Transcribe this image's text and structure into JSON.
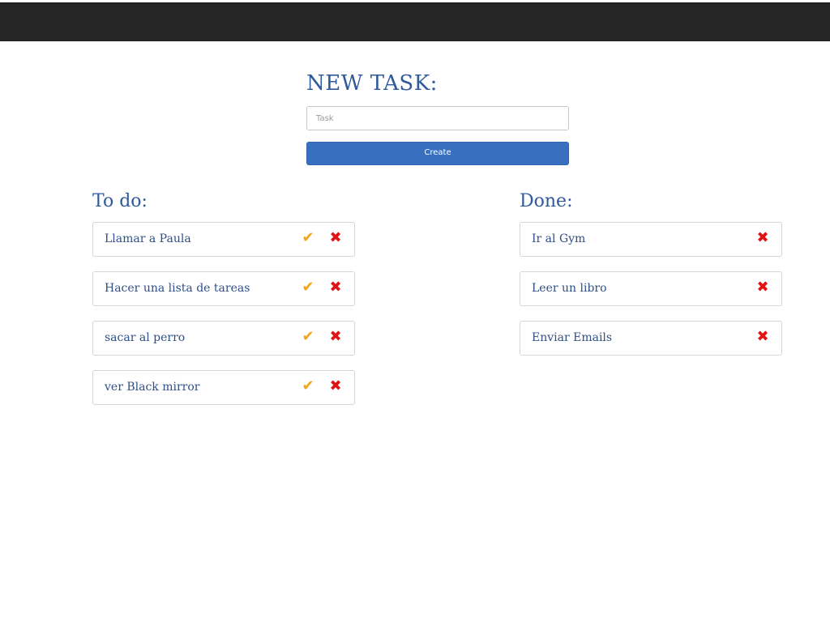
{
  "new_task": {
    "heading": "NEW TASK:",
    "input_placeholder": "Task",
    "input_value": "",
    "create_label": "Create"
  },
  "todo": {
    "heading": "To do:",
    "items": [
      {
        "label": "Llamar a Paula"
      },
      {
        "label": "Hacer una lista de tareas"
      },
      {
        "label": "sacar al perro"
      },
      {
        "label": "ver Black mirror"
      }
    ]
  },
  "done": {
    "heading": "Done:",
    "items": [
      {
        "label": "Ir al Gym"
      },
      {
        "label": "Leer un libro"
      },
      {
        "label": "Enviar Emails"
      }
    ]
  },
  "icons": {
    "complete": "check-icon",
    "delete": "close-icon"
  },
  "colors": {
    "topbar": "#262626",
    "accent": "#3870bf",
    "heading_text": "#2f5a9c",
    "check": "#f2a516",
    "delete": "#e01414"
  }
}
